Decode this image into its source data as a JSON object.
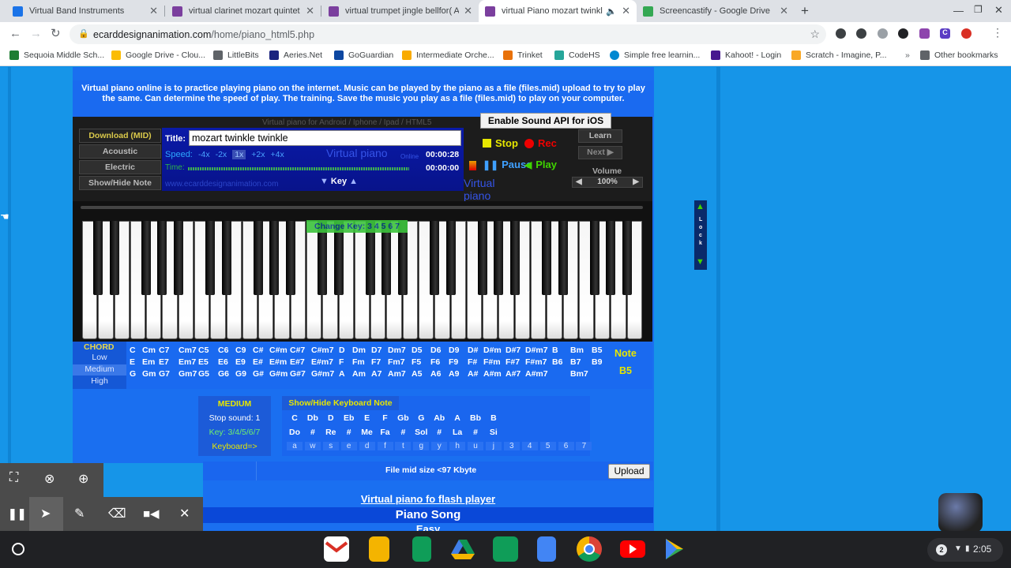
{
  "tabs": [
    {
      "title": "Virtual Band Instruments",
      "color": "#1a73e8"
    },
    {
      "title": "virtual clarinet mozart quintet k5",
      "color": "#7b3f9e"
    },
    {
      "title": "virtual trumpet jingle bellfor( And",
      "color": "#7b3f9e"
    },
    {
      "title": "virtual Piano mozart twinkle",
      "color": "#7b3f9e"
    },
    {
      "title": "Screencastify - Google Drive",
      "color": "#34a853"
    }
  ],
  "url": {
    "host": "ecarddesignanimation.com",
    "path": "/home/piano_html5.php"
  },
  "bookmarks": [
    "Sequoia Middle Sch...",
    "Google Drive - Clou...",
    "LittleBits",
    "Aeries.Net",
    "GoGuardian",
    "Intermediate Orche...",
    "Trinket",
    "CodeHS",
    "Simple free learnin...",
    "Kahoot! - Login",
    "Scratch - Imagine, P...",
    "Other bookmarks"
  ],
  "intro": "Virtual piano online is to practice playing piano on the internet. Music can be played by the piano as a file (files.mid) upload to try to play the same. Can determine the speed of play. The training. Save the music you play as a file (files.mid) to play on your computer.",
  "panel": {
    "header": "Virtual piano for Android / Iphone / Ipad / HTML5",
    "ios_btn": "Enable Sound API for iOS",
    "download": "Download (MID)",
    "acoustic": "Acoustic",
    "electric": "Electric",
    "shownote": "Show/Hide Note",
    "title_label": "Title:",
    "title_value": "mozart twinkle twinkle",
    "speed_label": "Speed:",
    "speeds": [
      "-4x",
      "-2x",
      "1x",
      "+2x",
      "+4x"
    ],
    "time_label": "Time:",
    "brand": "Virtual piano",
    "online": "Online",
    "t1": "00:00:28",
    "t2": "00:00:00",
    "site": "www.ecarddesignanimation.com",
    "key": "Key",
    "stop": "Stop",
    "rec": "Rec",
    "pause": "Pause",
    "play": "Play",
    "learn": "Learn",
    "next": "Next",
    "volume": "Volume",
    "volume_val": "100%"
  },
  "changekey": "Change Key: 3 4 5 6 7",
  "chord": {
    "label": "CHORD",
    "modes": [
      "Low",
      "Medium",
      "High"
    ],
    "rows": [
      [
        "C",
        "Cm",
        "C7",
        "Cm7",
        "C5",
        "C6",
        "C9",
        "C#",
        "C#m",
        "C#7",
        "C#m7",
        "D",
        "Dm",
        "D7",
        "Dm7",
        "D5",
        "D6",
        "D9",
        "D#",
        "D#m",
        "D#7",
        "D#m7",
        "B",
        "Bm",
        "B5"
      ],
      [
        "E",
        "Em",
        "E7",
        "Em7",
        "E5",
        "E6",
        "E9",
        "E#",
        "E#m",
        "E#7",
        "E#m7",
        "F",
        "Fm",
        "F7",
        "Fm7",
        "F5",
        "F6",
        "F9",
        "F#",
        "F#m",
        "F#7",
        "F#m7",
        "B6",
        "B7",
        "B9"
      ],
      [
        "G",
        "Gm",
        "G7",
        "Gm7",
        "G5",
        "G6",
        "G9",
        "G#",
        "G#m",
        "G#7",
        "G#m7",
        "A",
        "Am",
        "A7",
        "Am7",
        "A5",
        "A6",
        "A9",
        "A#",
        "A#m",
        "A#7",
        "A#m7",
        "",
        "Bm7",
        ""
      ]
    ],
    "note_label": "Note",
    "note_val": "B5"
  },
  "medium": {
    "title": "MEDIUM",
    "stop": "Stop sound: 1",
    "key": "Key: 3/4/5/6/7",
    "keyboard": "Keyboard=>"
  },
  "kbnote": {
    "title": "Show/Hide Keyboard Note",
    "notes": [
      "C",
      "Db",
      "D",
      "Eb",
      "E",
      "F",
      "Gb",
      "G",
      "Ab",
      "A",
      "Bb",
      "B"
    ],
    "solfege": [
      "Do",
      "#",
      "Re",
      "#",
      "Me",
      "Fa",
      "#",
      "Sol",
      "#",
      "La",
      "#",
      "Si"
    ],
    "keys": [
      "a",
      "w",
      "s",
      "e",
      "d",
      "f",
      "t",
      "g",
      "y",
      "h",
      "u",
      "j",
      "3",
      "4",
      "5",
      "6",
      "7"
    ]
  },
  "upload": {
    "size": "File mid size <97 Kbyte",
    "btn": "Upload"
  },
  "links": {
    "flash": "Virtual piano fo flash player",
    "song": "Piano Song",
    "easy": "Easy"
  },
  "lock": [
    "L",
    "o",
    "c",
    "k"
  ],
  "tray": {
    "badge": "2",
    "time": "2:05"
  }
}
